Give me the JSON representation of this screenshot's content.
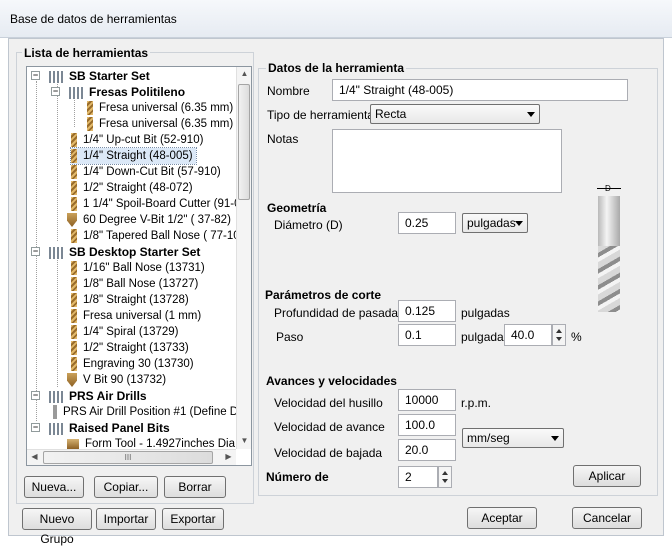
{
  "window": {
    "title": "Base de datos de herramientas"
  },
  "tree": {
    "title": "Lista de herramientas",
    "rows": [
      {
        "label": "SB Starter Set",
        "type": "group"
      },
      {
        "label": "Fresas Politileno",
        "type": "group"
      },
      {
        "label": "Fresa universal (6.35 mm)",
        "type": "tool"
      },
      {
        "label": "Fresa universal (6.35 mm)",
        "type": "tool"
      },
      {
        "label": "1/4\" Up-cut Bit (52-910)",
        "type": "tool"
      },
      {
        "label": "1/4\" Straight  (48-005)",
        "type": "tool"
      },
      {
        "label": "1/4\"  Down-Cut Bit (57-910)",
        "type": "tool"
      },
      {
        "label": "1/2\" Straight  (48-072)",
        "type": "tool"
      },
      {
        "label": "1 1/4\" Spoil-Board Cutter  (91-0",
        "type": "tool"
      },
      {
        "label": "60 Degree V-Bit 1/2\"  ( 37-82)",
        "type": "tool"
      },
      {
        "label": "1/8\" Tapered Ball Nose ( 77-10",
        "type": "tool"
      },
      {
        "label": "SB Desktop Starter Set",
        "type": "group"
      },
      {
        "label": "1/16\" Ball Nose (13731)",
        "type": "tool"
      },
      {
        "label": "1/8\" Ball Nose (13727)",
        "type": "tool"
      },
      {
        "label": "1/8\" Straight (13728)",
        "type": "tool"
      },
      {
        "label": "Fresa universal (1 mm)",
        "type": "tool"
      },
      {
        "label": "1/4\" Spiral (13729)",
        "type": "tool"
      },
      {
        "label": "1/2\" Straight (13733)",
        "type": "tool"
      },
      {
        "label": "Engraving 30 (13730)",
        "type": "tool"
      },
      {
        "label": "V Bit 90 (13732)",
        "type": "tool"
      },
      {
        "label": "PRS Air Drills",
        "type": "group"
      },
      {
        "label": "PRS Air Drill Position #1 (Define Dia",
        "type": "tool"
      },
      {
        "label": "Raised Panel Bits",
        "type": "group"
      },
      {
        "label": "Form Tool - 1.4927inches Dia",
        "type": "tool"
      }
    ],
    "hscroll_grip": "III"
  },
  "left_buttons": {
    "new": "Nueva...",
    "copy": "Copiar...",
    "delete": "Borrar",
    "new_group": "Nuevo Grupo",
    "import": "Importar",
    "export": "Exportar"
  },
  "details": {
    "title": "Datos de la herramienta",
    "name_label": "Nombre",
    "name_value": "1/4\" Straight  (48-005)",
    "type_label": "Tipo de herramienta",
    "type_value": "Recta",
    "notes_label": "Notas",
    "notes_value": ""
  },
  "geometry": {
    "title": "Geometría",
    "diameter_label": "Diámetro (D)",
    "diameter_value": "0.25",
    "units": "pulgadas",
    "diagram_label": "D"
  },
  "cutting": {
    "title": "Parámetros de corte",
    "depth_label": "Profundidad de pasada",
    "depth_value": "0.125",
    "depth_units": "pulgadas",
    "stepover_label": "Paso",
    "stepover_value": "0.1",
    "stepover_units": "pulgadas",
    "stepover_percent": "40.0",
    "percent_sign": "%"
  },
  "feeds": {
    "title": "Avances y velocidades",
    "spindle_label": "Velocidad del husillo",
    "spindle_value": "10000",
    "spindle_units": "r.p.m.",
    "feed_label": "Velocidad de avance",
    "feed_value": "100.0",
    "plunge_label": "Velocidad de bajada",
    "plunge_value": "20.0",
    "rate_units": "mm/seg"
  },
  "tool_number": {
    "label": "Número de",
    "value": "2"
  },
  "action_buttons": {
    "apply": "Aplicar",
    "accept": "Aceptar",
    "cancel": "Cancelar"
  }
}
